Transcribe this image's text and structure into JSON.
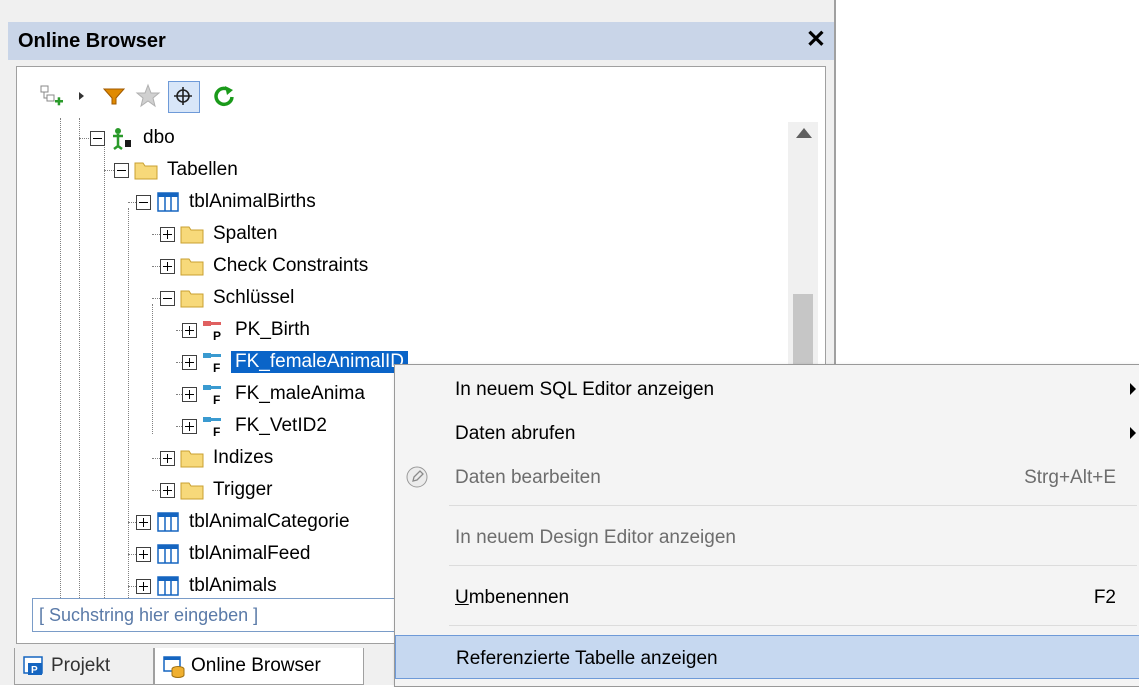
{
  "panel": {
    "title": "Online Browser",
    "close": "✕"
  },
  "toolbar": {
    "icons": [
      "add-objects-icon",
      "dropdown-arrow-icon",
      "filter-icon",
      "favorites-star-icon",
      "locate-icon",
      "refresh-icon"
    ]
  },
  "tree": {
    "dbo": "dbo",
    "tabellen": "Tabellen",
    "table1": "tblAnimalBirths",
    "spalten": "Spalten",
    "check": "Check Constraints",
    "schluessel": "Schlüssel",
    "pk_birth": "PK_Birth",
    "fk_female": "FK_femaleAnimalID",
    "fk_male": "FK_maleAnima",
    "fk_vet": "FK_VetID2",
    "indizes": "Indizes",
    "trigger": "Trigger",
    "table2": "tblAnimalCategorie",
    "table3": "tblAnimalFeed",
    "table4": "tblAnimals"
  },
  "search": {
    "placeholder": "[ Suchstring hier eingeben ]"
  },
  "tabs": {
    "projekt": "Projekt",
    "online": "Online Browser"
  },
  "context_menu": {
    "sql_editor": "In neuem SQL Editor anzeigen",
    "daten_abrufen": "Daten abrufen",
    "daten_bearbeiten": "Daten bearbeiten",
    "daten_bearbeiten_sc": "Strg+Alt+E",
    "design_editor": "In neuem Design Editor anzeigen",
    "umbenennen_u": "U",
    "umbenennen_rest": "mbenennen",
    "umbenennen_sc": "F2",
    "referenzierte": "Referenzierte Tabelle anzeigen"
  },
  "colors": {
    "selection": "#0a64c8",
    "title_bar": "#c9d5e8",
    "menu_highlight": "#c6d8f0",
    "refresh_green": "#1a9a1a",
    "filter_orange": "#e08a00"
  }
}
